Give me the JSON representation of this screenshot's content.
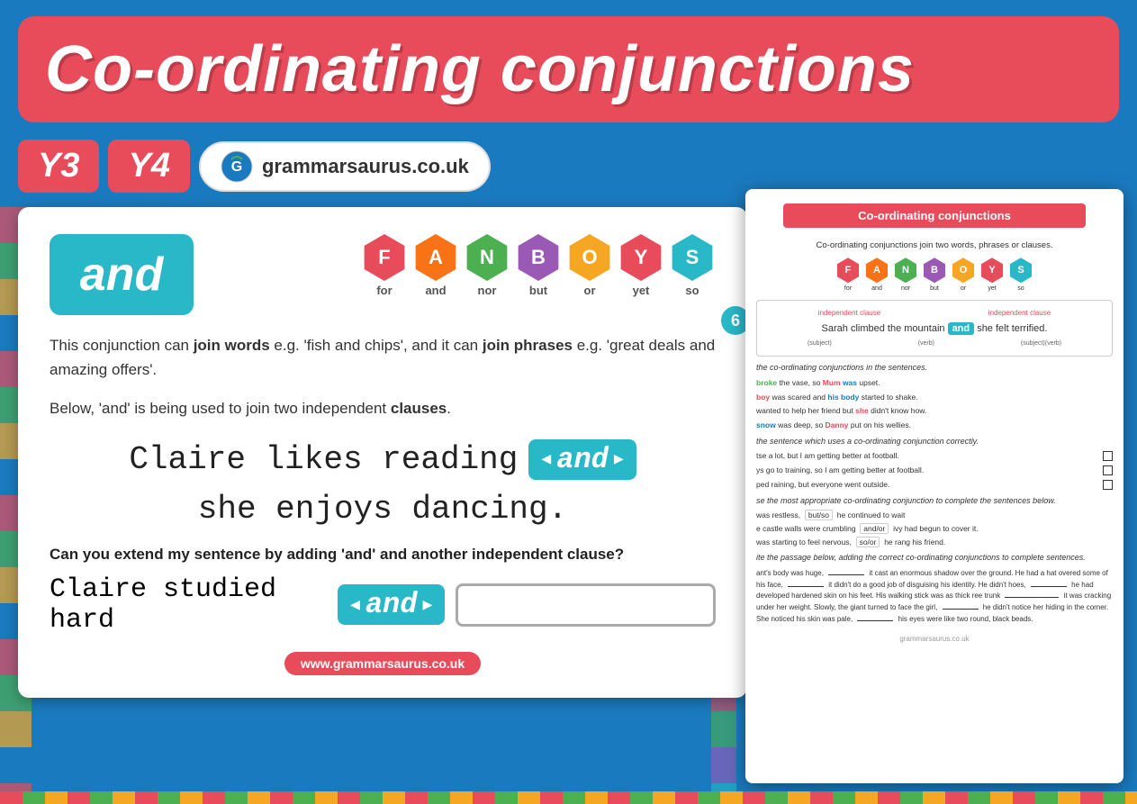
{
  "header": {
    "title": "Co-ordinating conjunctions",
    "background_color": "#e84b5a"
  },
  "badges": {
    "year3": "Y3",
    "year4": "Y4",
    "website": "grammarsaurus.co.uk"
  },
  "fanboys": {
    "letters": [
      "F",
      "A",
      "N",
      "B",
      "O",
      "Y",
      "S"
    ],
    "labels": [
      "for",
      "and",
      "nor",
      "but",
      "or",
      "yet",
      "so"
    ],
    "colors": [
      "#e84b5a",
      "#f97316",
      "#4caf50",
      "#9b59b6",
      "#f5a623",
      "#e84b5a",
      "#29b8c8"
    ]
  },
  "conjunction_card": {
    "word": "and",
    "bg_color": "#29b8c8",
    "description_line1": "This conjunction can ",
    "bold1": "join words",
    "description_mid1": " e.g. 'fish and chips', it can ",
    "bold2": "join phrases",
    "description_mid2": " e.g. 'great deals and amazing offers'.",
    "description_line2": "Below, 'and' is being used to join two independent ",
    "bold3": "clauses",
    "description_end": ".",
    "main_sentence_left": "Claire likes reading",
    "and_word": "and",
    "main_sentence_right": "she enjoys dancing.",
    "question": "Can you extend my sentence by adding 'and' and another independent clause?",
    "input_sentence_left": "Claire studied hard",
    "footer_url": "www.grammarsaurus.co.uk"
  },
  "worksheet": {
    "header_label": "Co-ordinating conjunctions",
    "subtitle": "Co-ordinating conjunctions join two words, phrases or clauses.",
    "page_number": "6",
    "star_color": "#f5a623",
    "example_sentence_left": "Sarah climbed the mountain",
    "example_and": "and",
    "example_sentence_right": "she felt terrified.",
    "labels": {
      "independent_clause": "independent clause",
      "subject": "(subject)",
      "verb": "(verb)"
    },
    "section1_label": "the co-ordinating conjunctions in the sentences.",
    "sentences": [
      "broke the vase, so Mum was upset.",
      "boy was scared and his body started to shake.",
      "wanted to help her friend but she didn't know how.",
      "snow was deep, so Danny put on his wellies."
    ],
    "section2_label": "the sentence which uses a co-ordinating conjunction correctly.",
    "checkbox_items": [
      "tse a lot, but I am getting better at football.",
      "ys go to training, so I am getting better at football.",
      "ped raining, but everyone went outside."
    ],
    "section3_label": "se the most appropriate co-ordinating conjunction to complete the sentences below.",
    "fill_items": [
      "was restless,   but/so   he continued to wait",
      "e castle walls were crumbling   and/or   ivy had begun to cover it.",
      "was starting to feel nervous,   so/or   he rang his friend."
    ],
    "passage_label": "ite the passage below, adding the correct co-ordinating conjunctions to complete sentences.",
    "passage": "ant's body was huge, ______ it cast an enormous shadow over the ground. He had a hat overed some of his face, ______ it didn't do a good job of disguising his identity. He didn't hoes, ______ he had developed hardened skin on his feet. His walking stick was as thick ree trunk __________ it was cracking under her weight. Slowly, the giant turned to face the girl, ______ he didn't notice her hiding in the corner. She noticed his skin was pale, ______ his eyes were like two round, black beads.",
    "footer_logo": "grammarsaurus.co.uk"
  }
}
